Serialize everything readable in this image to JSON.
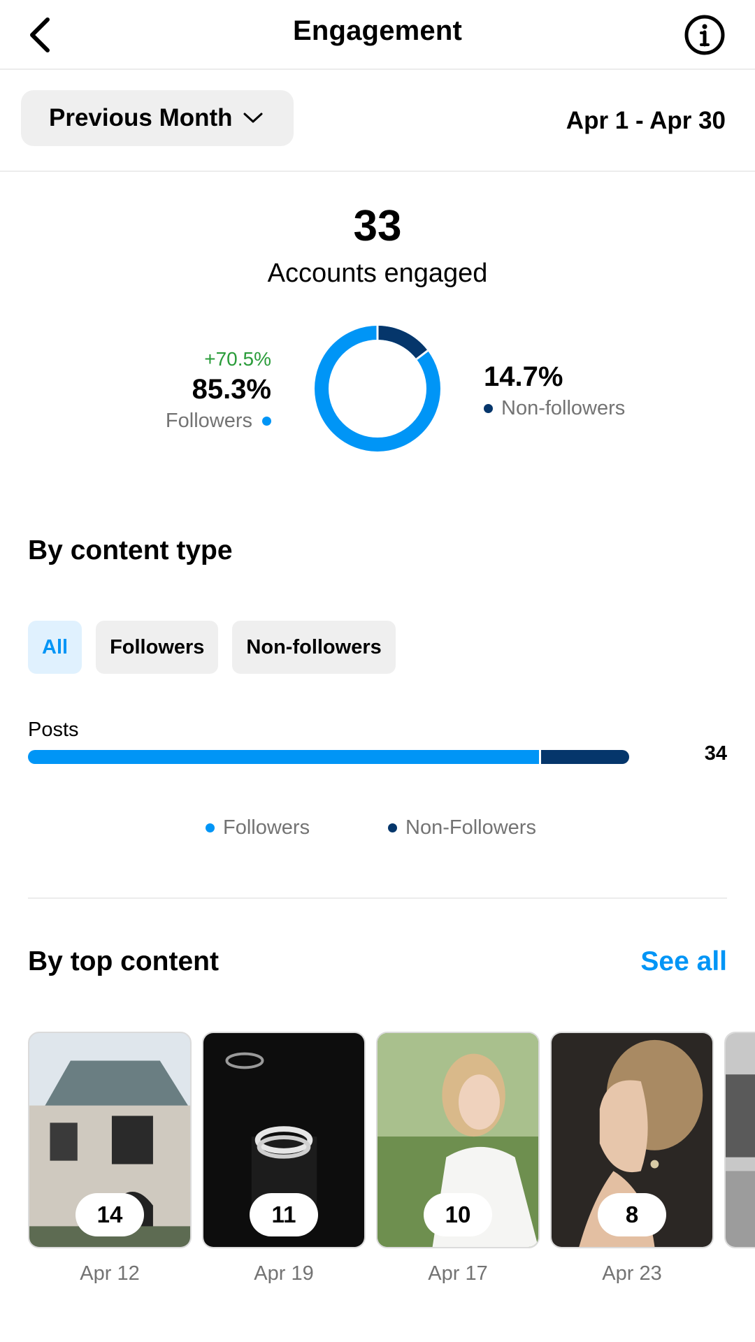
{
  "header": {
    "title": "Engagement",
    "back_icon": "chevron-left-icon",
    "info_icon": "info-circle-icon"
  },
  "filter": {
    "period_label": "Previous Month",
    "dropdown_icon": "chevron-down-icon",
    "date_range": "Apr 1 - Apr 30"
  },
  "summary": {
    "total": "33",
    "total_label": "Accounts engaged",
    "followers": {
      "delta": "+70.5%",
      "percent": "85.3%",
      "label": "Followers",
      "fraction": 0.853
    },
    "non_followers": {
      "percent": "14.7%",
      "label": "Non-followers",
      "fraction": 0.147
    }
  },
  "content_type": {
    "title": "By content type",
    "chips": [
      {
        "label": "All",
        "active": true
      },
      {
        "label": "Followers",
        "active": false
      },
      {
        "label": "Non-followers",
        "active": false
      }
    ],
    "posts": {
      "label": "Posts",
      "value": "34",
      "followers_fraction": 0.853,
      "non_followers_fraction": 0.147
    },
    "legend": {
      "followers": "Followers",
      "non_followers": "Non-Followers"
    }
  },
  "top_content": {
    "title": "By top content",
    "see_all": "See all",
    "items": [
      {
        "count": "14",
        "date": "Apr 12"
      },
      {
        "count": "11",
        "date": "Apr 19"
      },
      {
        "count": "10",
        "date": "Apr 17"
      },
      {
        "count": "8",
        "date": "Apr 23"
      }
    ]
  },
  "colors": {
    "followers": "#0095f6",
    "non_followers": "#05366b",
    "delta_positive": "#2a9c3a",
    "link": "#0095f6"
  }
}
